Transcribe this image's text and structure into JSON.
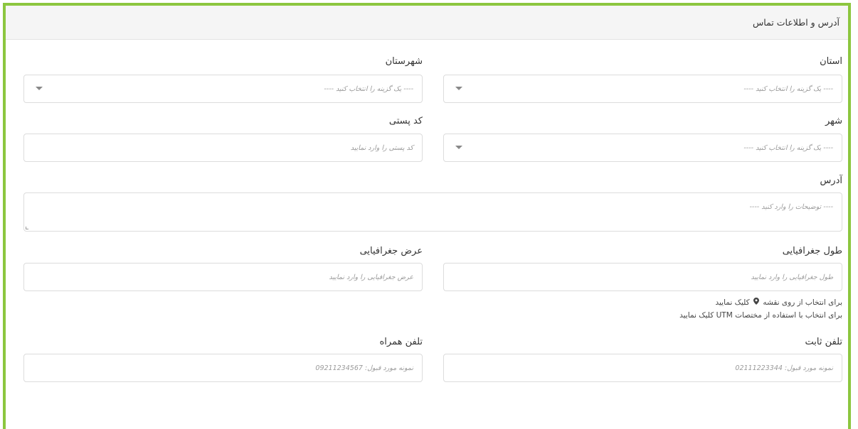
{
  "section": {
    "title": "آدرس و اطلاعات تماس"
  },
  "form": {
    "province": {
      "label": "استان",
      "placeholder": "---- یک گزینه را انتخاب کنید ----"
    },
    "county": {
      "label": "شهرستان",
      "placeholder": "---- یک گزینه را انتخاب کنید ----"
    },
    "city": {
      "label": "شهر",
      "placeholder": "---- یک گزینه را انتخاب کنید ----"
    },
    "postal_code": {
      "label": "کد پستی",
      "placeholder": "کد پستی را وارد نمایید"
    },
    "address": {
      "label": "آدرس",
      "placeholder": "---- توضیحات را وارد کنید ----"
    },
    "longitude": {
      "label": "طول جغرافیایی",
      "placeholder": "طول جغرافیایی را وارد نمایید"
    },
    "latitude": {
      "label": "عرض جغرافیایی",
      "placeholder": "عرض جغرافیایی را وارد نمایید"
    },
    "map_note_before": "برای انتخاب از روی نقشه",
    "map_note_after": "کلیک نمایید",
    "utm_note": "برای انتخاب با استفاده از مختصات UTM کلیک نمایید",
    "landline": {
      "label": "تلفن ثابت",
      "placeholder": "نمونه مورد قبول: 02111223344"
    },
    "mobile": {
      "label": "تلفن همراه",
      "placeholder": "نمونه مورد قبول: 09211234567"
    }
  },
  "colors": {
    "accent_border": "#8cc63f",
    "header_bg": "#f5f5f5"
  },
  "icons": {
    "map_pin": "map-marker-icon",
    "select_caret": "caret-down-icon"
  }
}
